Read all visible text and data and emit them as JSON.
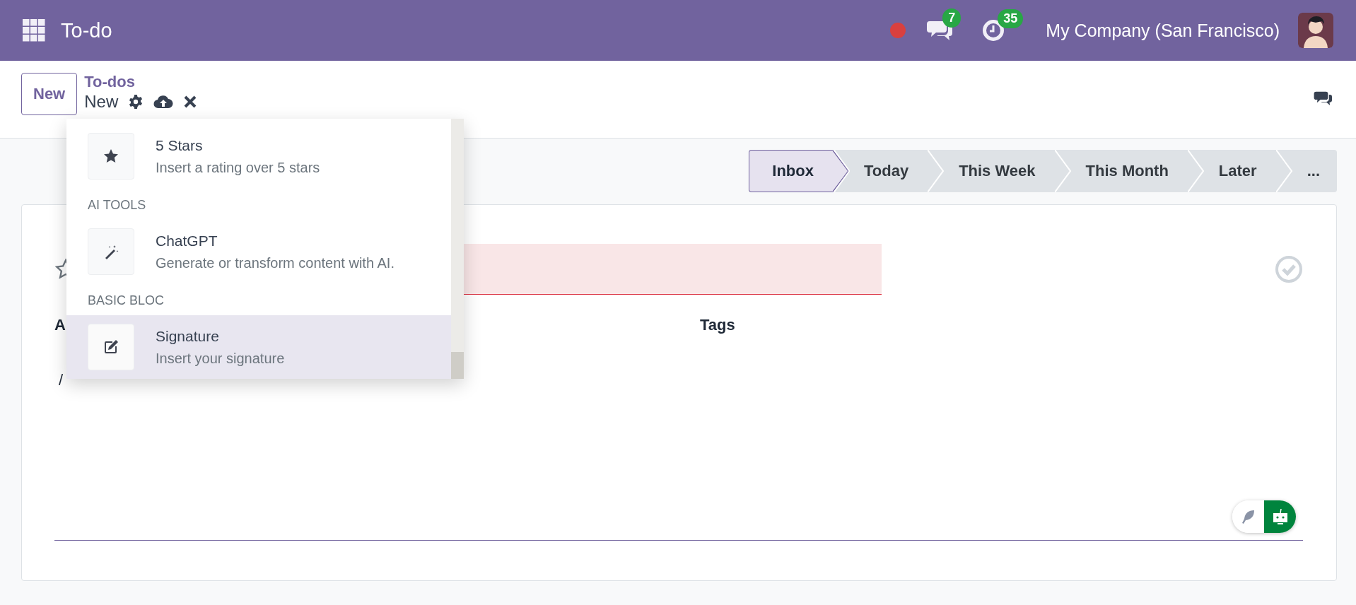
{
  "navbar": {
    "app_title": "To-do",
    "messages_count": "7",
    "activities_count": "35",
    "company": "My Company (San Francisco)"
  },
  "control_panel": {
    "new_button": "New",
    "breadcrumb": "To-dos",
    "record_name": "New"
  },
  "stages": [
    {
      "label": "Inbox",
      "selected": true
    },
    {
      "label": "Today",
      "selected": false
    },
    {
      "label": "This Week",
      "selected": false
    },
    {
      "label": "This Month",
      "selected": false
    },
    {
      "label": "Later",
      "selected": false
    },
    {
      "label": "...",
      "selected": false
    }
  ],
  "form": {
    "title_field": {
      "invalid": true
    },
    "fields": [
      {
        "label": "A"
      },
      {
        "label": "Tags"
      }
    ],
    "description": "/"
  },
  "command_menu": {
    "entries": [
      {
        "kind": "command",
        "title": "5 Stars",
        "description": "Insert a rating over 5 stars",
        "selected": false
      },
      {
        "kind": "header",
        "label": "AI TOOLS"
      },
      {
        "kind": "command",
        "title": "ChatGPT",
        "description": "Generate or transform content with AI.",
        "selected": false
      },
      {
        "kind": "header",
        "label": "BASIC BLOC"
      },
      {
        "kind": "command",
        "title": "Signature",
        "description": "Insert your signature",
        "selected": true
      }
    ]
  }
}
